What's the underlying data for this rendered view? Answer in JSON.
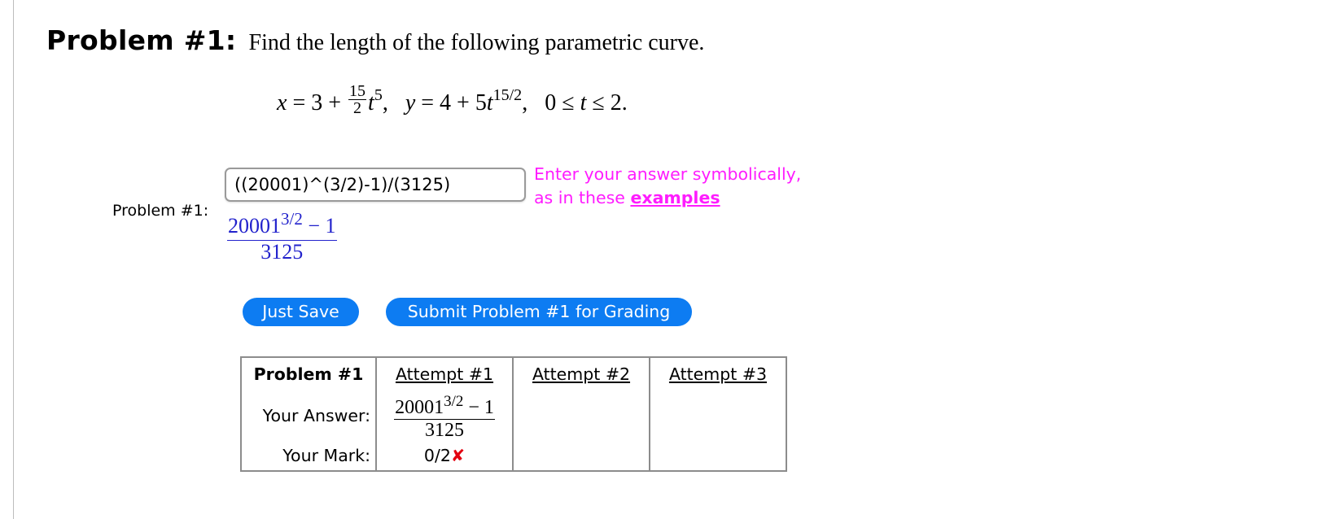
{
  "problem": {
    "label": "Problem #1:",
    "statement": "Find the length of the following parametric curve.",
    "equation": {
      "x_lhs": "x",
      "x_const": "3",
      "x_coef_num": "15",
      "x_coef_den": "2",
      "x_var": "t",
      "x_exp": "5",
      "y_lhs": "y",
      "y_const": "4",
      "y_coef": "5",
      "y_var": "t",
      "y_exp": "15/2",
      "range_low": "0",
      "range_var": "t",
      "range_high": "2."
    }
  },
  "answer": {
    "side_label": "Problem #1:",
    "input_value": "((20001)^(3/2)-1)/(3125)",
    "hint_line1": "Enter your answer symbolically,",
    "hint_line2_prefix": "as in these",
    "hint_link": "examples",
    "preview": {
      "base": "20001",
      "exp": "3/2",
      "tail": "− 1",
      "den": "3125"
    }
  },
  "buttons": {
    "save": "Just Save",
    "submit": "Submit Problem #1 for Grading"
  },
  "attempts_table": {
    "header": [
      "Problem #1",
      "Attempt #1",
      "Attempt #2",
      "Attempt #3"
    ],
    "your_answer_label": "Your Answer:",
    "your_mark_label": "Your Mark:",
    "attempt1_answer": {
      "base": "20001",
      "exp": "3/2",
      "tail": "− 1",
      "den": "3125"
    },
    "attempt1_mark": "0/2",
    "attempt1_mark_icon": "x-mark-icon"
  }
}
